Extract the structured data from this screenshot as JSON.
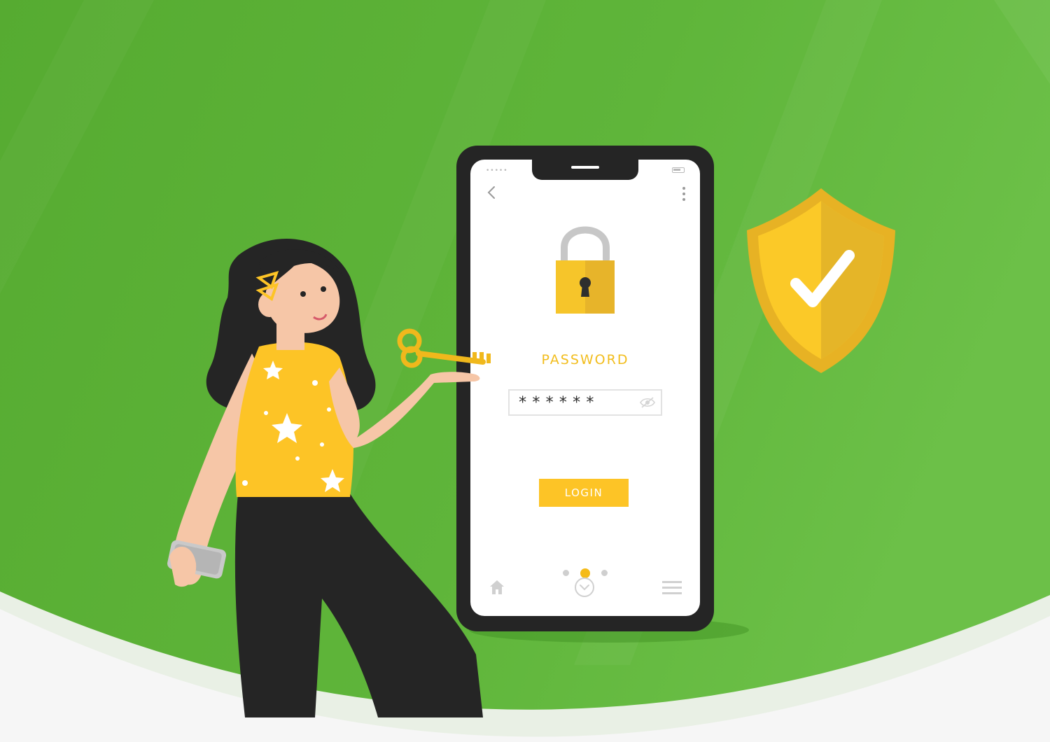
{
  "screen": {
    "status_dots": "•••••",
    "password_label": "PASSWORD",
    "password_value": "******",
    "login_label": "LOGIN",
    "pagination": {
      "total": 3,
      "active": 2
    }
  },
  "icons": {
    "back": "chevron-left-icon",
    "more": "more-vertical-icon",
    "lock": "padlock-icon",
    "eye": "eye-icon",
    "home": "home-icon",
    "down": "chevron-down-circle-icon",
    "menu": "hamburger-menu-icon",
    "shield": "shield-check-icon",
    "key": "key-icon"
  },
  "colors": {
    "background": "#5aaf35",
    "accent": "#fdc426",
    "phone": "#252525",
    "text_dark": "#2e2e2e"
  }
}
